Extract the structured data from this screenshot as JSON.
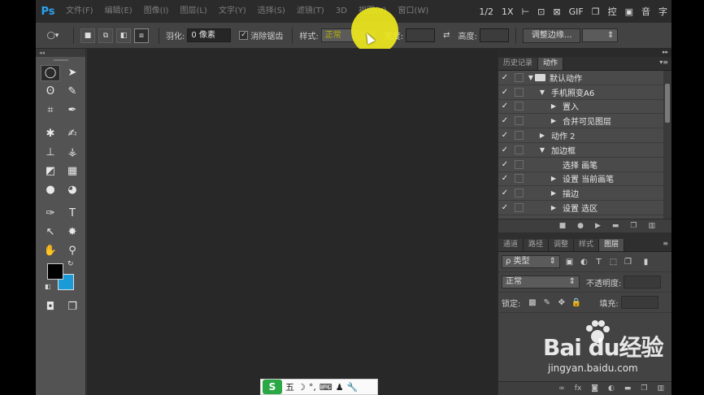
{
  "app": {
    "logo": "Ps"
  },
  "menu": {
    "items": [
      "文件(F)",
      "编辑(E)",
      "图像(I)",
      "图层(L)",
      "文字(Y)",
      "选择(S)",
      "滤镜(T)",
      "3D",
      "视图(V)",
      "窗口(W)"
    ],
    "right": [
      "1/2",
      "1X",
      "⊢",
      "⊡",
      "⊠",
      "GIF",
      "❐",
      "控",
      "▣",
      "音",
      "字"
    ]
  },
  "options": {
    "feather_label": "羽化:",
    "feather_value": "0 像素",
    "antialias_label": "消除锯齿",
    "style_label": "样式:",
    "style_value": "正常",
    "width_label": "宽度:",
    "height_label": "高度:",
    "refine_edge": "调整边缘..."
  },
  "tools_panel": {
    "collapse": "◂◂"
  },
  "actions_panel": {
    "tabs": [
      "历史记录",
      "动作"
    ],
    "active_tab": "动作",
    "rows": [
      {
        "label": "默认动作",
        "indent": 0,
        "arrow": "▼",
        "folder": true
      },
      {
        "label": "手机照变A6",
        "indent": 1,
        "arrow": "▼",
        "folder": false
      },
      {
        "label": "置入",
        "indent": 2,
        "arrow": "▶",
        "folder": false
      },
      {
        "label": "合并可见图层",
        "indent": 2,
        "arrow": "▶",
        "folder": false
      },
      {
        "label": "动作 2",
        "indent": 1,
        "arrow": "▶",
        "folder": false
      },
      {
        "label": "加边框",
        "indent": 1,
        "arrow": "▼",
        "folder": false
      },
      {
        "label": "选择 画笔",
        "indent": 2,
        "arrow": "",
        "folder": false
      },
      {
        "label": "设置 当前画笔",
        "indent": 2,
        "arrow": "▶",
        "folder": false
      },
      {
        "label": "描边",
        "indent": 2,
        "arrow": "▶",
        "folder": false
      },
      {
        "label": "设置 选区",
        "indent": 2,
        "arrow": "▶",
        "folder": false
      }
    ]
  },
  "layers_panel": {
    "tabs": [
      "通道",
      "路径",
      "调整",
      "样式",
      "图层"
    ],
    "active_tab": "图层",
    "filter_label": "ρ 类型",
    "blend_mode": "正常",
    "opacity_label": "不透明度:",
    "lock_label": "锁定:",
    "fill_label": "填充:"
  },
  "ime": {
    "logo": "S",
    "mode": "五",
    "items": [
      "☽",
      "°,",
      "⌨",
      "♟",
      "🔧"
    ]
  },
  "watermark": {
    "main": "Bai  du经验",
    "sub": "jingyan.baidu.com"
  },
  "colors": {
    "foreground": "#000000",
    "background": "#1a9bd7",
    "highlight": "#eee81e"
  }
}
